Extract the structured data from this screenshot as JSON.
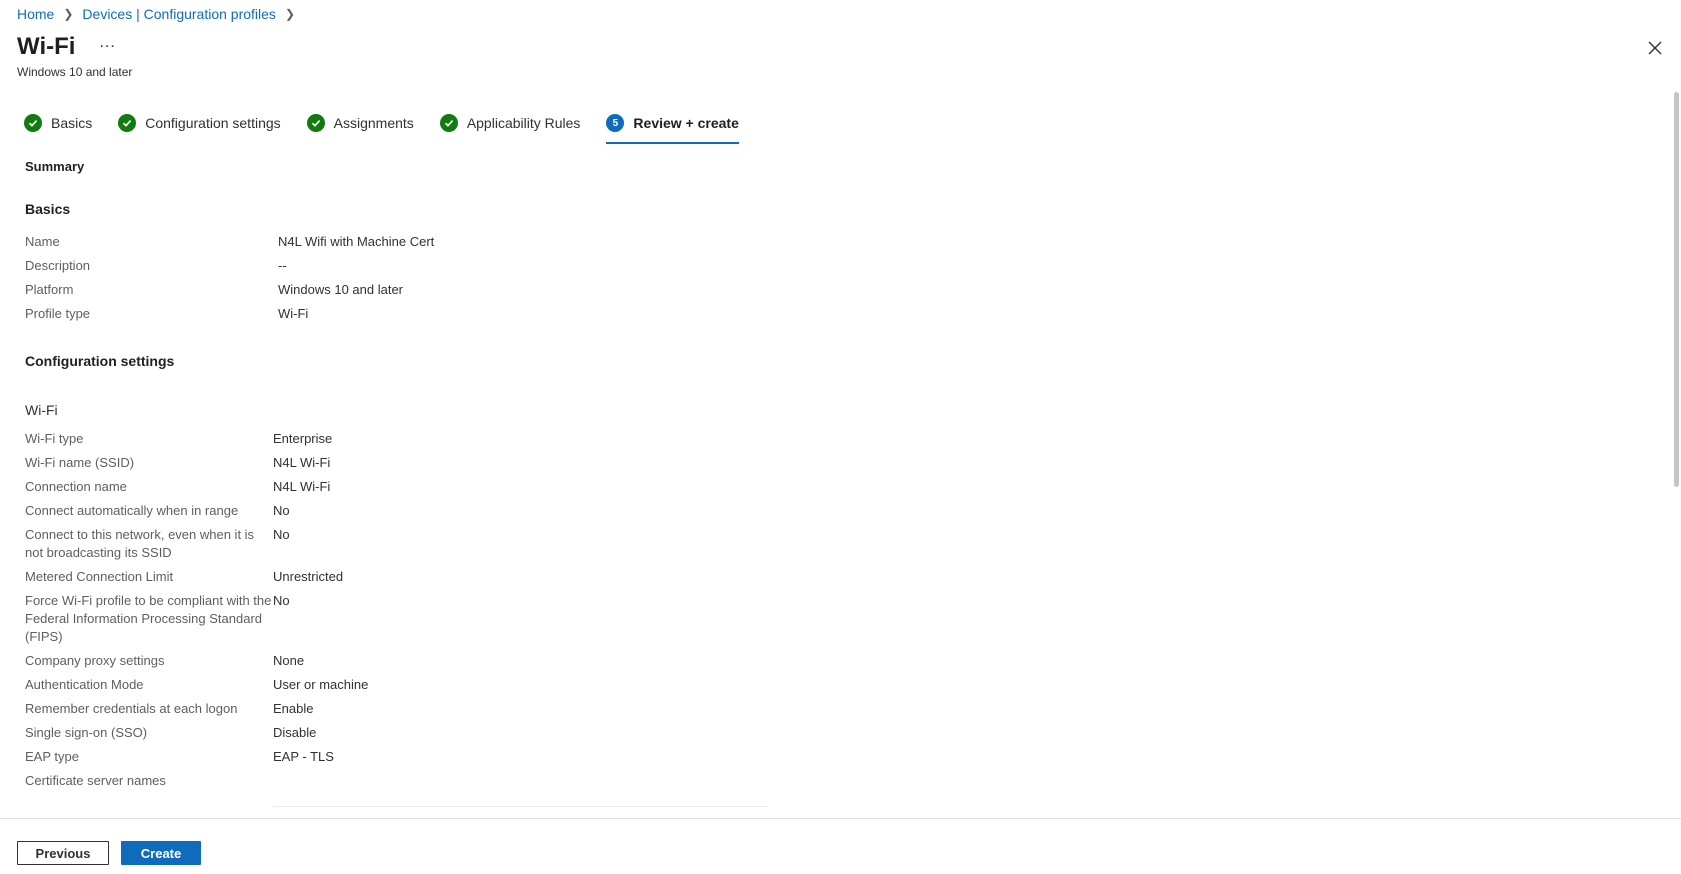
{
  "breadcrumb": {
    "items": [
      {
        "label": "Home"
      },
      {
        "label": "Devices | Configuration profiles"
      }
    ]
  },
  "header": {
    "title": "Wi-Fi",
    "more": "...",
    "subtitle": "Windows 10 and later"
  },
  "tabs": [
    {
      "label": "Basics",
      "state": "complete"
    },
    {
      "label": "Configuration settings",
      "state": "complete"
    },
    {
      "label": "Assignments",
      "state": "complete"
    },
    {
      "label": "Applicability Rules",
      "state": "complete"
    },
    {
      "label": "Review + create",
      "state": "active",
      "step": "5"
    }
  ],
  "summary": {
    "heading": "Summary",
    "basics": {
      "heading": "Basics",
      "rows": [
        {
          "label": "Name",
          "value": "N4L Wifi with Machine Cert"
        },
        {
          "label": "Description",
          "value": "--"
        },
        {
          "label": "Platform",
          "value": "Windows 10 and later"
        },
        {
          "label": "Profile type",
          "value": "Wi-Fi"
        }
      ]
    },
    "config": {
      "heading": "Configuration settings",
      "group": "Wi-Fi",
      "rows": [
        {
          "label": "Wi-Fi type",
          "value": "Enterprise"
        },
        {
          "label": "Wi-Fi name (SSID)",
          "value": "N4L Wi-Fi"
        },
        {
          "label": "Connection name",
          "value": "N4L Wi-Fi"
        },
        {
          "label": "Connect automatically when in range",
          "value": "No"
        },
        {
          "label": "Connect to this network, even when it is not broadcasting its SSID",
          "value": "No"
        },
        {
          "label": "Metered Connection Limit",
          "value": "Unrestricted"
        },
        {
          "label": "Force Wi-Fi profile to be compliant with the Federal Information Processing Standard (FIPS)",
          "value": "No"
        },
        {
          "label": "Company proxy settings",
          "value": "None"
        },
        {
          "label": "Authentication Mode",
          "value": "User or machine"
        },
        {
          "label": "Remember credentials at each logon",
          "value": "Enable"
        },
        {
          "label": "Single sign-on (SSO)",
          "value": "Disable"
        },
        {
          "label": "EAP type",
          "value": "EAP - TLS"
        },
        {
          "label": "Certificate server names",
          "value": ""
        }
      ]
    }
  },
  "footer": {
    "previous_label": "Previous",
    "create_label": "Create"
  },
  "colors": {
    "accent": "#0f6cbd",
    "success": "#107c10"
  }
}
